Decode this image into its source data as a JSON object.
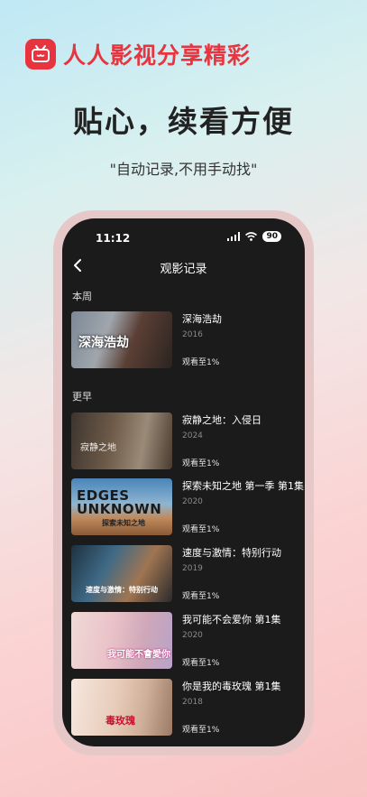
{
  "brand": {
    "logo_icon": "tv-icon",
    "name": "人人影视分享精彩"
  },
  "headline": "贴心，续看方便",
  "subline": "\"自动记录,不用手动找\"",
  "status_bar": {
    "time": "11:12",
    "battery": "90"
  },
  "nav": {
    "title": "观影记录"
  },
  "sections": {
    "this_week": "本周",
    "earlier": "更早"
  },
  "items": [
    {
      "title": "深海浩劫",
      "year": "2016",
      "progress": "观看至1%",
      "thumb_text": "深海浩劫"
    },
    {
      "title": "寂静之地：入侵日",
      "year": "2024",
      "progress": "观看至1%",
      "thumb_text": "寂静之地"
    },
    {
      "title": "探索未知之地 第一季 第1集",
      "year": "2020",
      "progress": "观看至1%",
      "thumb_text": "EDGES UNKNOWN",
      "thumb_sub": "探索未知之地"
    },
    {
      "title": "速度与激情：特别行动",
      "year": "2019",
      "progress": "观看至1%",
      "thumb_text": "速度与激情：特别行动"
    },
    {
      "title": "我可能不会爱你 第1集",
      "year": "2020",
      "progress": "观看至1%",
      "thumb_text": "我可能不會愛你"
    },
    {
      "title": "你是我的毒玫瑰 第1集",
      "year": "2018",
      "progress": "观看至1%",
      "thumb_text": "毒玫瑰"
    }
  ]
}
